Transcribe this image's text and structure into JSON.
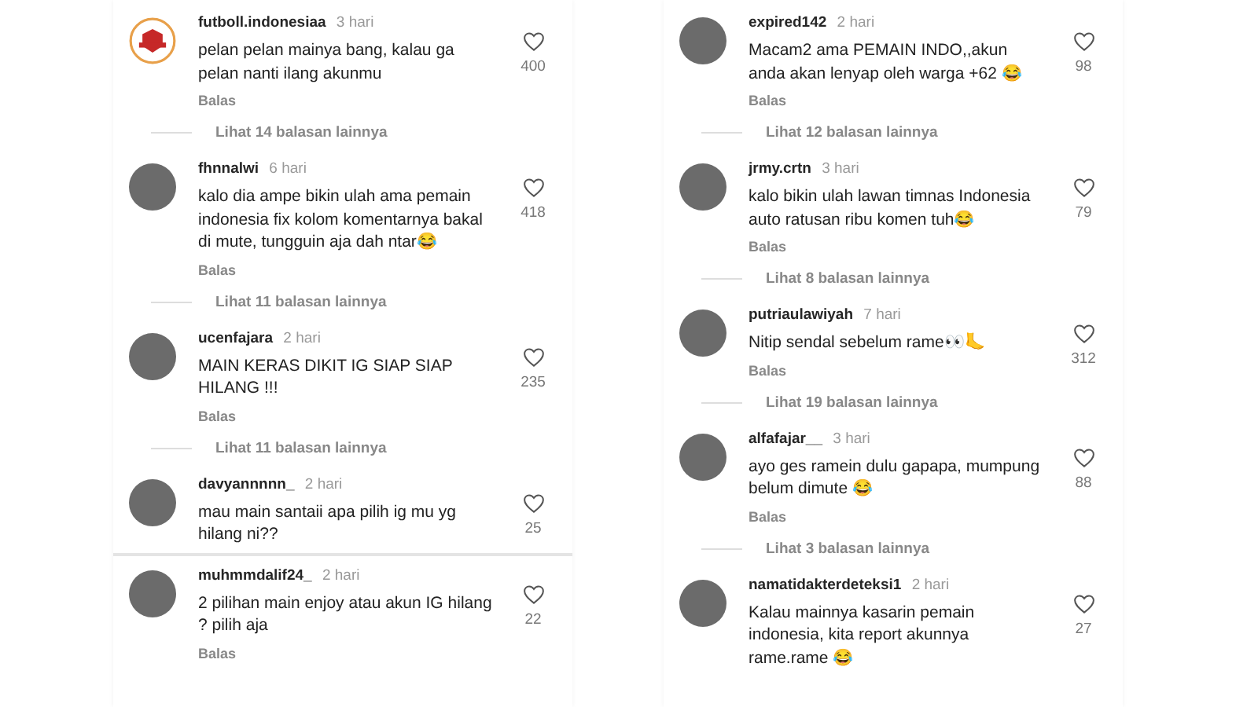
{
  "panels": [
    {
      "sections": [
        {
          "comments": [
            {
              "kind": "logo",
              "username": "futboll.indonesiaa",
              "time": "3 hari",
              "text": "pelan pelan mainya bang, kalau ga pelan nanti ilang akunmu",
              "likes": "400",
              "reply": "Balas",
              "view_replies": "Lihat 14 balasan lainnya"
            },
            {
              "kind": "photo",
              "username": "fhnnalwi",
              "time": "6 hari",
              "text": "kalo dia ampe bikin ulah ama pemain indonesia fix kolom komentarnya bakal di mute, tungguin aja dah ntar😂",
              "likes": "418",
              "reply": "Balas",
              "view_replies": "Lihat 11 balasan lainnya"
            },
            {
              "kind": "photo",
              "username": "ucenfajara",
              "time": "2 hari",
              "text": "MAIN KERAS DIKIT IG SIAP SIAP HILANG !!!",
              "likes": "235",
              "reply": "Balas",
              "view_replies": "Lihat 11 balasan lainnya"
            },
            {
              "kind": "photo",
              "username": "davyannnnn_",
              "time": "2 hari",
              "text": "mau main santaii apa pilih ig mu yg hilang ni??",
              "likes": "25"
            }
          ]
        },
        {
          "comments": [
            {
              "kind": "photo",
              "username": "muhmmdalif24_",
              "time": "2 hari",
              "text": "2 pilihan main enjoy atau akun IG hilang ? pilih aja",
              "likes": "22",
              "reply": "Balas"
            }
          ]
        }
      ]
    },
    {
      "sections": [
        {
          "comments": [
            {
              "kind": "photo",
              "username": "expired142",
              "time": "2 hari",
              "text": "Macam2 ama PEMAIN INDO,,akun anda akan lenyap oleh warga +62 😂",
              "likes": "98",
              "reply": "Balas",
              "view_replies": "Lihat 12 balasan lainnya"
            },
            {
              "kind": "photo",
              "username": "jrmy.crtn",
              "time": "3 hari",
              "text": "kalo bikin ulah lawan timnas Indonesia auto ratusan ribu komen tuh😂",
              "likes": "79",
              "reply": "Balas",
              "view_replies": "Lihat 8 balasan lainnya"
            },
            {
              "kind": "photo",
              "username": "putriaulawiyah",
              "time": "7 hari",
              "text": "Nitip sendal sebelum rame👀🦶",
              "likes": "312",
              "reply": "Balas",
              "view_replies": "Lihat 19 balasan lainnya"
            },
            {
              "kind": "photo",
              "username": "alfafajar__",
              "time": "3 hari",
              "text": "ayo ges ramein dulu gapapa, mumpung belum dimute 😂",
              "likes": "88",
              "reply": "Balas",
              "view_replies": "Lihat 3 balasan lainnya"
            },
            {
              "kind": "photo",
              "username": "namatidakterdeteksi1",
              "time": "2 hari",
              "text": "Kalau mainnya kasarin pemain indonesia, kita report akunnya rame.rame 😂",
              "likes": "27"
            }
          ]
        }
      ]
    }
  ]
}
